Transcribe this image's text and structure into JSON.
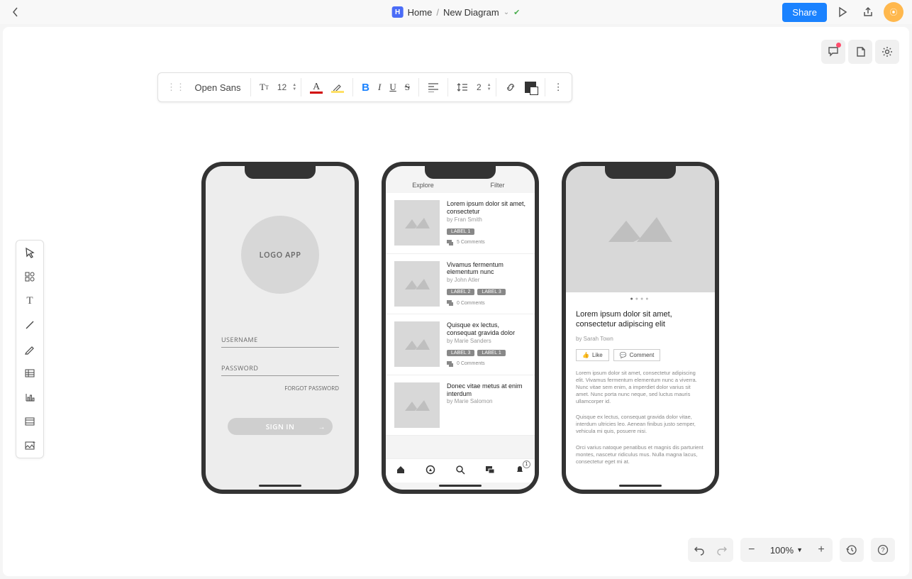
{
  "topbar": {
    "home": "Home",
    "doc": "New Diagram",
    "share": "Share"
  },
  "toolbar": {
    "font": "Open Sans",
    "size": "12",
    "lineheight": "2"
  },
  "zoom": {
    "value": "100%"
  },
  "phone1": {
    "logo": "LOGO APP",
    "username": "USERNAME",
    "password": "PASSWORD",
    "forgot": "FORGOT PASSWORD",
    "signin": "SIGN IN"
  },
  "phone2": {
    "tabs": {
      "explore": "Explore",
      "filter": "Filter"
    },
    "items": [
      {
        "title": "Lorem ipsum dolor sit amet, consectetur",
        "author": "by Fran Smith",
        "labels": [
          "LABEL 1"
        ],
        "comments": "5 Comments"
      },
      {
        "title": "Vivamus fermentum elementum nunc",
        "author": "by John Atler",
        "labels": [
          "LABEL 2",
          "LABEL 3"
        ],
        "comments": "0 Comments"
      },
      {
        "title": "Quisque ex lectus, consequat gravida dolor",
        "author": "by Marie Sanders",
        "labels": [
          "LABEL 3",
          "LABEL 1"
        ],
        "comments": "0 Comments"
      },
      {
        "title": "Donec vitae metus at enim interdum",
        "author": "by Marie Salomon",
        "labels": [],
        "comments": ""
      }
    ],
    "badge": "1"
  },
  "phone3": {
    "title": "Lorem ipsum dolor sit amet, consectetur adipiscing elit",
    "author": "by Sarah Town",
    "like": "Like",
    "comment": "Comment",
    "para1": "Lorem ipsum dolor sit amet, consectetur adipiscing elit. Vivamus fermentum elementum nunc a viverra. Nunc vitae sem enim, a imperdiet dolor varius sit amet. Nunc porta nunc neque, sed luctus mauris ullamcorper id.",
    "para2": "Quisque ex lectus, consequat gravida dolor vitae, interdum ultricies leo. Aenean finibus justo semper, vehicula mi quis, posuere nisi.",
    "para3": "Orci varius natoque penatibus et magnis dis parturient montes, nascetur ridiculus mus. Nulla magna lacus, consectetur eget mi at."
  }
}
